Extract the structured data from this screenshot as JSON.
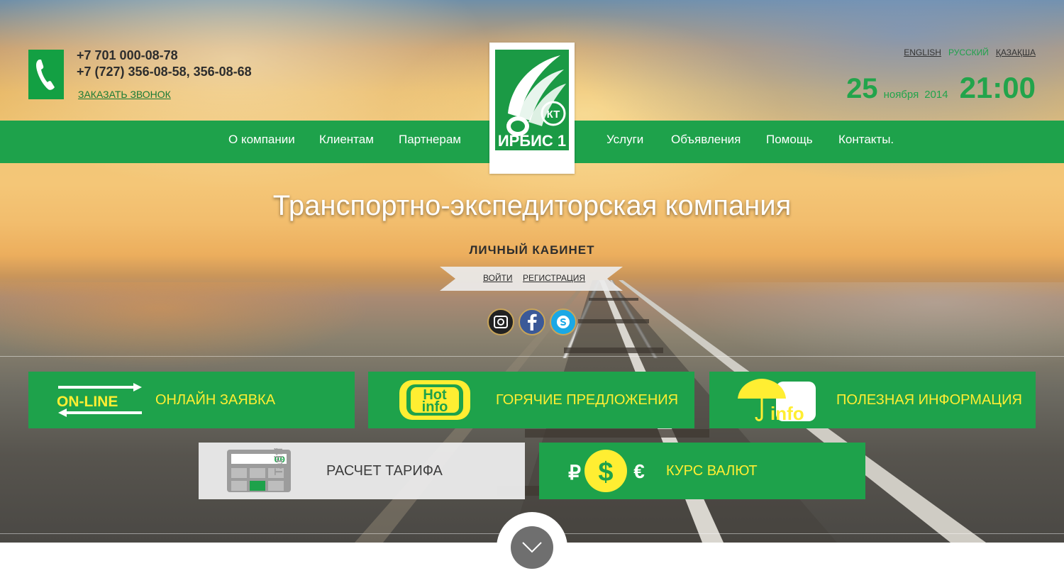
{
  "header": {
    "phone_line1": "+7 701 000-08-78",
    "phone_line2": "+7 (727) 356-08-58, 356-08-68",
    "callback_label": "ЗАКАЗАТЬ ЗВОНОК",
    "phone_icon": "phone-icon"
  },
  "languages": [
    {
      "label": "ENGLISH",
      "active": false
    },
    {
      "label": "РУССКИЙ",
      "active": true
    },
    {
      "label": "ҚАЗАҚША",
      "active": false
    }
  ],
  "datetime": {
    "day": "25",
    "month": "ноября",
    "year": "2014",
    "time": "21:00"
  },
  "logo": {
    "text": "ИРБИС 1",
    "badge": "КТ",
    "accent": "#1b9a45"
  },
  "nav": {
    "left": [
      "О компании",
      "Клиентам",
      "Партнерам"
    ],
    "right": [
      "Услуги",
      "Объявления",
      "Помощь",
      "Контакты."
    ]
  },
  "hero": {
    "headline": "Транспортно-экспедиторская компания",
    "cabinet_title": "ЛИЧНЫЙ КАБИНЕТ",
    "login_label": "ВОЙТИ",
    "register_label": "РЕГИСТРАЦИЯ"
  },
  "social": [
    "instagram-icon",
    "facebook-icon",
    "skype-icon"
  ],
  "tiles": [
    {
      "label": "ОНЛАЙН ЗАЯВКА",
      "icon": "online-arrows-icon",
      "icon_text": "ON-LINE"
    },
    {
      "label": "ГОРЯЧИЕ ПРЕДЛОЖЕНИЯ",
      "icon": "hot-info-icon",
      "icon_text_top": "Hot",
      "icon_text_bottom": "info"
    },
    {
      "label": "ПОЛЕЗНАЯ ИНФОРМАЦИЯ",
      "icon": "umbrella-info-icon",
      "icon_text": "info"
    },
    {
      "label": "РАСЧЕТ ТАРИФА",
      "icon": "calculator-icon",
      "icon_text": "Tariff",
      "display": "00"
    },
    {
      "label": "КУРС ВАЛЮТ",
      "icon": "currency-icon"
    }
  ],
  "colors": {
    "brand_green": "#1ea24b",
    "accent_yellow": "#ffee32"
  },
  "scroll_icon": "chevron-down-icon"
}
